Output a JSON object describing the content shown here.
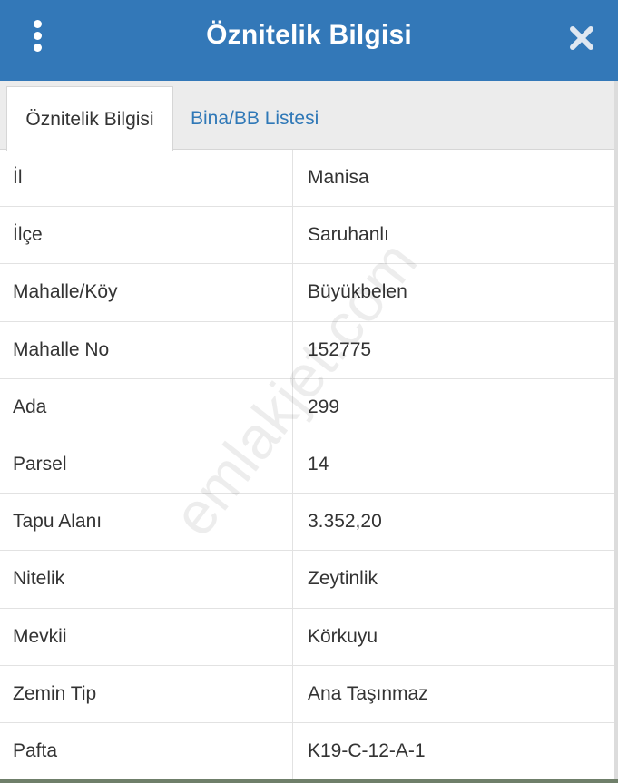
{
  "header": {
    "title": "Öznitelik Bilgisi",
    "menu_icon": "vertical-dots-icon",
    "close_icon": "close-icon",
    "accent_color": "#3378b8"
  },
  "tabs": [
    {
      "label": "Öznitelik Bilgisi",
      "active": true
    },
    {
      "label": "Bina/BB Listesi",
      "active": false
    }
  ],
  "rows": [
    {
      "label": "İl",
      "value": "Manisa"
    },
    {
      "label": "İlçe",
      "value": "Saruhanlı"
    },
    {
      "label": "Mahalle/Köy",
      "value": "Büyükbelen"
    },
    {
      "label": "Mahalle No",
      "value": "152775"
    },
    {
      "label": "Ada",
      "value": "299"
    },
    {
      "label": "Parsel",
      "value": "14"
    },
    {
      "label": "Tapu Alanı",
      "value": "3.352,20"
    },
    {
      "label": "Nitelik",
      "value": "Zeytinlik"
    },
    {
      "label": "Mevkii",
      "value": "Körkuyu"
    },
    {
      "label": "Zemin Tip",
      "value": "Ana Taşınmaz"
    },
    {
      "label": "Pafta",
      "value": "K19-C-12-A-1"
    }
  ],
  "watermark": "emlakjet.com"
}
